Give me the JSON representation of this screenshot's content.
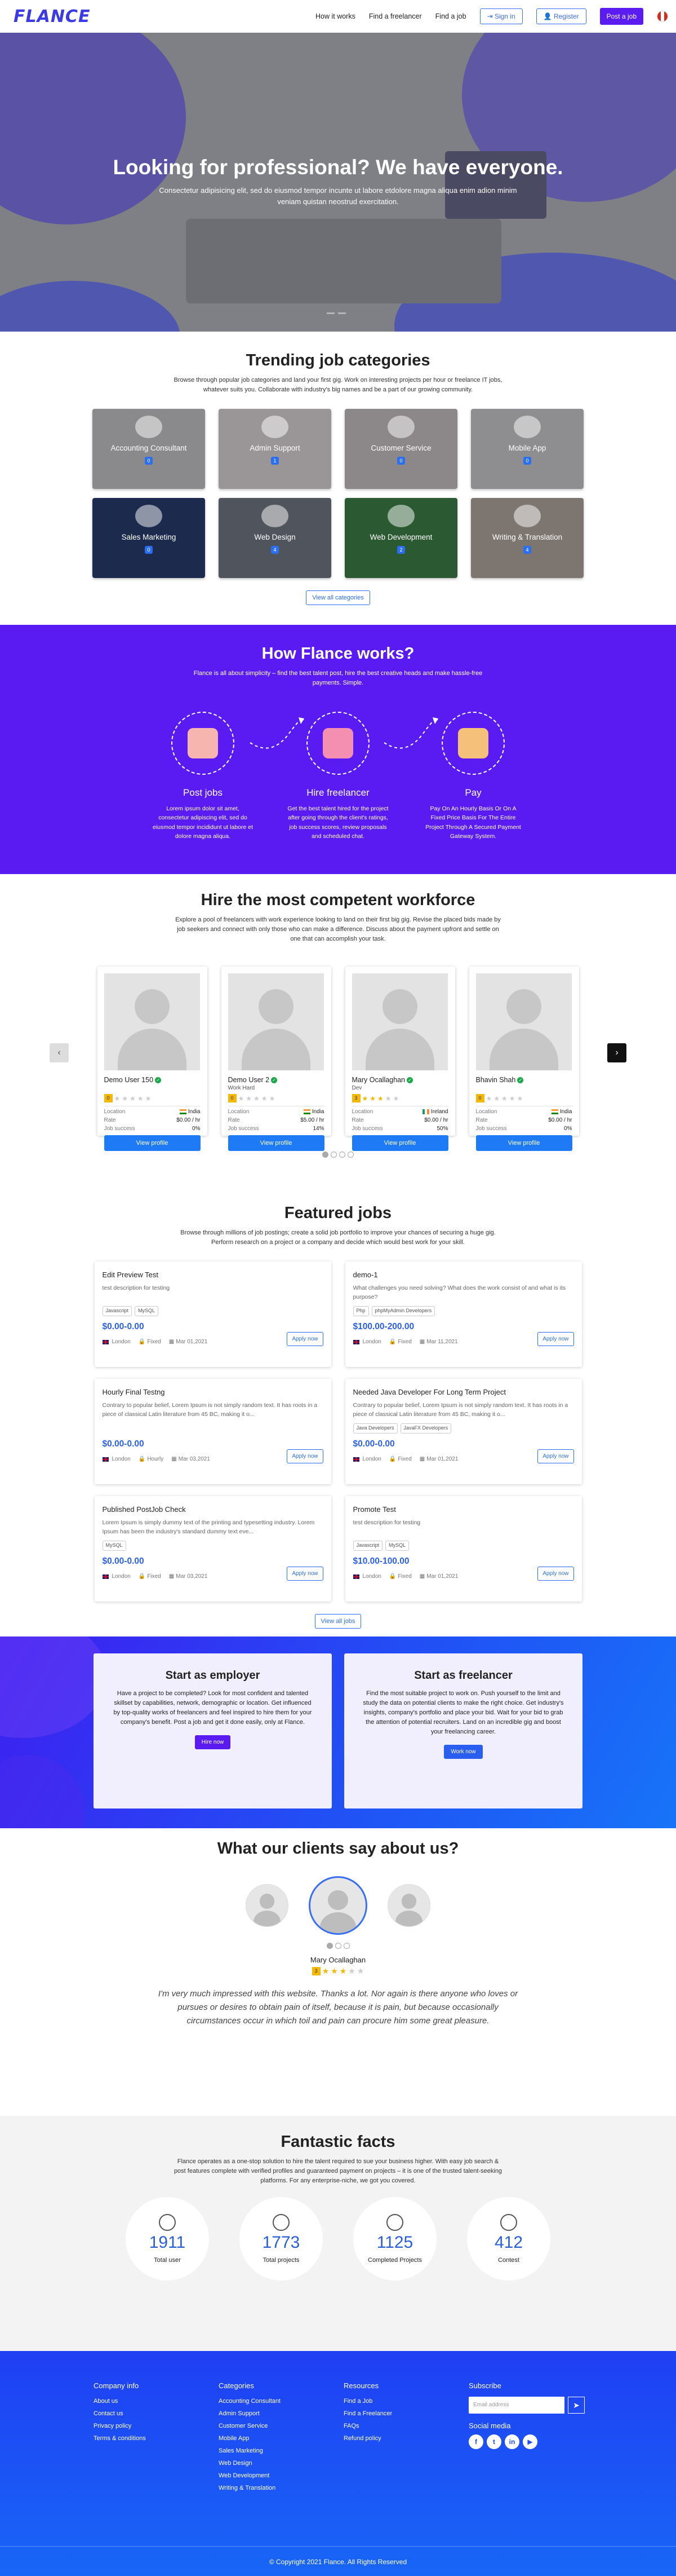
{
  "header": {
    "logo": "FLANCE",
    "nav": [
      "How it works",
      "Find a freelancer",
      "Find a job"
    ],
    "signin": "Sign in",
    "register": "Register",
    "post_job": "Post a job"
  },
  "hero": {
    "title": "Looking for professional? We have everyone.",
    "subtitle": "Consectetur adipisicing elit, sed do eiusmod tempor incunte ut labore etdolore magna aliqua enim adion minim veniam quistan neostrud exercitation."
  },
  "categories": {
    "title": "Trending job categories",
    "desc": "Browse through popular job categories and land your first gig. Work on interesting projects per hour or freelance IT jobs, whatever suits you. Collaborate with industry's big names and be a part of our growing community.",
    "items": [
      {
        "name": "Accounting Consultant",
        "count": "0",
        "color": "#8a8a8c"
      },
      {
        "name": "Admin Support",
        "count": "1",
        "color": "#9a9698"
      },
      {
        "name": "Customer Service",
        "count": "0",
        "color": "#8c8788"
      },
      {
        "name": "Mobile App",
        "count": "0",
        "color": "#8e8e90"
      },
      {
        "name": "Sales Marketing",
        "count": "0",
        "color": "#1b2a4d"
      },
      {
        "name": "Web Design",
        "count": "4",
        "color": "#50545c"
      },
      {
        "name": "Web Development",
        "count": "2",
        "color": "#2b5a32"
      },
      {
        "name": "Writing & Translation",
        "count": "4",
        "color": "#7d7670"
      }
    ],
    "view_all": "View all categories"
  },
  "how": {
    "title": "How Flance works?",
    "desc": "Flance is all about simplicity – find the best talent post, hire the best creative heads and make hassle-free payments. Simple.",
    "steps": [
      {
        "title": "Post jobs",
        "desc": "Lorem ipsum dolor sit amet, consectetur adipiscing elit, sed do eiusmod tempor incididunt ut labore et dolore magna aliqua.",
        "icon": "post-jobs-icon",
        "color": "#f7b5b0"
      },
      {
        "title": "Hire freelancer",
        "desc": "Get the best talent hired for the project after going through the client's ratings, job success scores, review proposals and scheduled chat.",
        "icon": "hire-freelancer-icon",
        "color": "#f48fb1"
      },
      {
        "title": "Pay",
        "desc": "Pay On An Hourly Basis Or On A Fixed Price Basis For The Entire Project Through A Secured Payment Gateway System.",
        "icon": "pay-icon",
        "color": "#f5c07a"
      }
    ]
  },
  "workforce": {
    "title": "Hire the most competent workforce",
    "desc": "Explore a pool of freelancers with work experience looking to land on their first big gig. Revise the placed bids made by job seekers and connect with only those who can make a difference. Discuss about the payment upfront and settle on one that can accomplish your task.",
    "labels": {
      "location": "Location",
      "rate": "Rate",
      "job_success": "Job success",
      "view": "View profile"
    },
    "freelancers": [
      {
        "name": "Demo User 150",
        "title": "",
        "rating": "0",
        "stars": 0,
        "country": "India",
        "flag": "in",
        "rate": "$0.00 / hr",
        "success": "0%"
      },
      {
        "name": "Demo User 2",
        "title": "Work Hard",
        "rating": "0",
        "stars": 0,
        "country": "India",
        "flag": "in",
        "rate": "$5.00 / hr",
        "success": "14%"
      },
      {
        "name": "Mary Ocallaghan",
        "title": "Dev",
        "rating": "3",
        "stars": 3,
        "country": "Ireland",
        "flag": "ie",
        "rate": "$0.00 / hr",
        "success": "50%"
      },
      {
        "name": "Bhavin Shah",
        "title": "",
        "rating": "0",
        "stars": 0,
        "country": "India",
        "flag": "in",
        "rate": "$0.00 / hr",
        "success": "0%"
      }
    ],
    "prev": "‹",
    "next": "›"
  },
  "jobs": {
    "title": "Featured jobs",
    "desc": "Browse through millions of job postings; create a solid job portfolio to improve your chances of securing a huge gig. Perform research on a project or a company and decide which would best work for your skill.",
    "apply": "Apply now",
    "items": [
      {
        "title": "Edit Preview Test",
        "desc": "test description for testing",
        "tags": [
          "Javascript",
          "MySQL"
        ],
        "price": "$0.00-0.00",
        "location": "London",
        "type": "Fixed",
        "date": "Mar 01,2021"
      },
      {
        "title": "demo-1",
        "desc": "What challenges you need solving? What does the work consist of and what is its purpose?",
        "tags": [
          "Php",
          "phpMyAdmin Developers"
        ],
        "price": "$100.00-200.00",
        "location": "London",
        "type": "Fixed",
        "date": "Mar 11,2021"
      },
      {
        "title": "Hourly Final Testng",
        "desc": "Contrary to popular belief, Lorem Ipsum is not simply random text. It has roots in a piece of classical Latin literature from 45 BC, making it o...",
        "tags": [],
        "price": "$0.00-0.00",
        "location": "London",
        "type": "Hourly",
        "date": "Mar 03,2021"
      },
      {
        "title": "Needed Java Developer For Long Term Project",
        "desc": "Contrary to popular belief, Lorem Ipsum is not simply random text. It has roots in a piece of classical Latin literature from 45 BC, making it o...",
        "tags": [
          "Java Developers",
          "JavaFX Developers"
        ],
        "price": "$0.00-0.00",
        "location": "London",
        "type": "Fixed",
        "date": "Mar 01,2021"
      },
      {
        "title": "Published PostJob Check",
        "desc": "Lorem Ipsum is simply dummy text of the printing and typesetting industry. Lorem Ipsum has been the industry's standard dummy text eve...",
        "tags": [
          "MySQL"
        ],
        "price": "$0.00-0.00",
        "location": "London",
        "type": "Fixed",
        "date": "Mar 03,2021"
      },
      {
        "title": "Promote Test",
        "desc": "test description for testing",
        "tags": [
          "Javascript",
          "MySQL"
        ],
        "price": "$10.00-100.00",
        "location": "London",
        "type": "Fixed",
        "date": "Mar 01,2021"
      }
    ],
    "view_all": "View all jobs"
  },
  "start": {
    "employer": {
      "title": "Start as employer",
      "desc": "Have a project to be completed? Look for most confident and talented skillset by capabilities, network, demographic or location. Get influenced by top-quality works of freelancers and feel inspired to hire them for your company's benefit. Post a job and get it done easily, only at Flance.",
      "btn": "Hire now"
    },
    "freelancer": {
      "title": "Start as freelancer",
      "desc": "Find the most suitable project to work on. Push yourself to the limit and study the data on potential clients to make the right choice. Get industry's insights, company's portfolio and place your bid. Wait for your bid to grab the attention of potential recruiters. Land on an incredible gig and boost your freelancing career.",
      "btn": "Work now"
    }
  },
  "clients": {
    "title": "What our clients say about us?",
    "name": "Mary Ocallaghan",
    "rating": "3",
    "stars": 3,
    "quote": "I'm very much impressed with this website. Thanks a lot. Nor again is there anyone who loves or pursues or desires to obtain pain of itself, because it is pain, but because occasionally circumstances occur in which toil and pain can procure him some great pleasure."
  },
  "facts": {
    "title": "Fantastic facts",
    "desc": "Flance operates as a one-stop solution to hire the talent required to sue your business higher. With easy job search & post features complete with verified profiles and guaranteed payment on projects – it is one of the trusted talent-seeking platforms. For any enterprise-niche, we got you covered.",
    "items": [
      {
        "num": "1911",
        "label": "Total user",
        "icon": "users-icon"
      },
      {
        "num": "1773",
        "label": "Total projects",
        "icon": "projects-icon"
      },
      {
        "num": "1125",
        "label": "Completed Projects",
        "icon": "completed-icon"
      },
      {
        "num": "412",
        "label": "Contest",
        "icon": "contest-icon"
      }
    ]
  },
  "footer": {
    "company": {
      "title": "Company info",
      "links": [
        "About us",
        "Contact us",
        "Privacy policy",
        "Terms & conditions"
      ]
    },
    "categories": {
      "title": "Categories",
      "links": [
        "Accounting Consultant",
        "Admin Support",
        "Customer Service",
        "Mobile App",
        "Sales Marketing",
        "Web Design",
        "Web Development",
        "Writing & Translation"
      ]
    },
    "resources": {
      "title": "Resources",
      "links": [
        "Find a Job",
        "Find a Freelancer",
        "FAQs",
        "Refund policy"
      ]
    },
    "subscribe": {
      "title": "Subscribe",
      "placeholder": "Email address"
    },
    "social_title": "Social media",
    "social": [
      "f",
      "t",
      "in",
      "▶"
    ],
    "copyright": "© Copyright 2021 Flance. All Rights Reserved"
  }
}
